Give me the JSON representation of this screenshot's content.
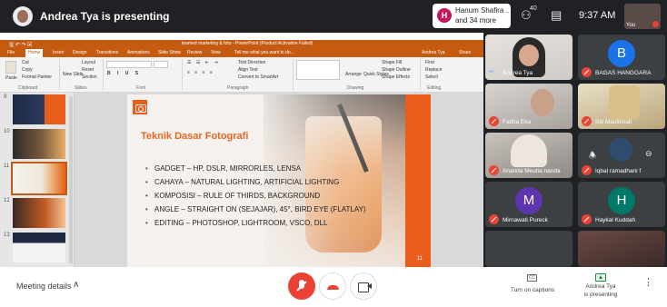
{
  "topbar": {
    "presenter_title": "Andrea Tya is presenting",
    "join_line1": "Hanum Shafira ...",
    "join_line2": "and 34 more",
    "join_initial": "H",
    "people_count": "40",
    "clock": "9:37 AM",
    "self_label": "You"
  },
  "powerpoint": {
    "title": "teamed marketing & foto - PowerPoint (Product Activation Failed)",
    "tabs": [
      "File",
      "Home",
      "Insert",
      "Design",
      "Transitions",
      "Animations",
      "Slide Show",
      "Review",
      "View",
      "Tell me what you want to do..."
    ],
    "ribbon": {
      "paste": "Paste",
      "cut": "Cut",
      "copy": "Copy",
      "format_painter": "Format Painter",
      "clipboard_group": "Clipboard",
      "new_slide": "New Slide",
      "layout": "Layout",
      "reset": "Reset",
      "section": "Section",
      "slides_group": "Slides",
      "font_group": "Font",
      "paragraph_group": "Paragraph",
      "text_direction": "Text Direction",
      "align_text": "Align Text",
      "convert_smartart": "Convert to SmartArt",
      "arrange": "Arrange",
      "quick_styles": "Quick Styles",
      "shape_fill": "Shape Fill",
      "shape_outline": "Shape Outline",
      "shape_effects": "Shape Effects",
      "drawing_group": "Drawing",
      "find": "Find",
      "replace": "Replace",
      "select": "Select",
      "editing_group": "Editing",
      "signed_in": "Andrea Tya",
      "share": "Share"
    },
    "slide_numbers": [
      "9",
      "10",
      "11",
      "12",
      "13"
    ],
    "slide": {
      "heading": "Teknik Dasar Fotografi",
      "bullets": [
        "GADGET – HP, DSLR, MIRRORLES, LENSA",
        "CAHAYA – NATURAL LIGHTING, ARTIFICIAL LIGHTING",
        "KOMPOSISI – RULE OF THIRDS, BACKGROUND",
        "ANGLE – STRAIGHT ON (SEJAJAR), 45°, BIRD EYE (FLATLAY)",
        "EDITING – PHOTOSHOP, LIGHTROOM, VSCO, DLL"
      ],
      "page_number": "11"
    }
  },
  "participants": [
    {
      "name": "Andrea Tya",
      "type": "video",
      "muted": false
    },
    {
      "name": "BAGAS HANGGARA",
      "type": "avatar",
      "initial": "B",
      "color": "#1a73e8",
      "muted": true
    },
    {
      "name": "Fatiha Eka",
      "type": "video",
      "muted": true
    },
    {
      "name": "Siti Maulikhah",
      "type": "video",
      "muted": true
    },
    {
      "name": "Ananda Meutia nanda",
      "type": "video",
      "muted": true
    },
    {
      "name": "Iqbal ramadhani f",
      "type": "video",
      "muted": true
    },
    {
      "name": "Mirnawati Pureck",
      "type": "avatar",
      "initial": "M",
      "color": "#5e35b1",
      "muted": true
    },
    {
      "name": "Haykal Kuddah",
      "type": "avatar",
      "initial": "H",
      "color": "#00796b",
      "muted": true
    }
  ],
  "bottombar": {
    "meeting_details": "Meeting details",
    "captions": "Turn on captions",
    "captions_icon": "CC",
    "presenting_line1": "Andrea Tya",
    "presenting_line2": "is presenting"
  }
}
